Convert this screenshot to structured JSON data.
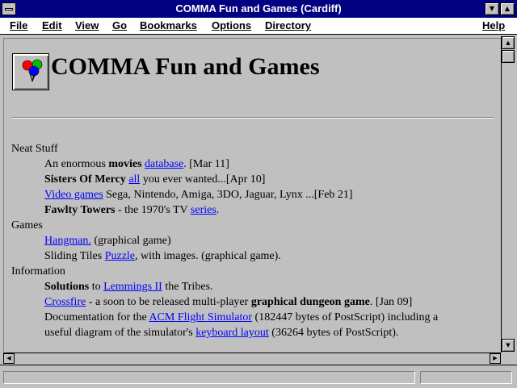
{
  "window": {
    "title": "COMMA Fun and Games (Cardiff)"
  },
  "menu": [
    "File",
    "Edit",
    "View",
    "Go",
    "Bookmarks",
    "Options",
    "Directory",
    "Help"
  ],
  "page": {
    "heading": "COMMA Fun and Games",
    "sections": {
      "neat": "Neat Stuff",
      "games": "Games",
      "info": "Information"
    },
    "lines": {
      "movies": {
        "pre": "An enormous ",
        "bold": "movies",
        "link": "database",
        "post": ". [Mar 11]"
      },
      "sisters": {
        "bold": "Sisters Of Mercy",
        "link": "all",
        "post": " you ever wanted...[Apr 10]"
      },
      "videogames": {
        "link": "Video games",
        "post": " Sega, Nintendo, Amiga, 3DO, Jaguar, Lynx ...[Feb 21]"
      },
      "fawlty": {
        "bold": "Fawlty Towers",
        "mid": " - the 1970's TV ",
        "link": "series",
        "post": "."
      },
      "hangman": {
        "link": "Hangman.",
        "post": " (graphical game)"
      },
      "tiles": {
        "pre": "Sliding Tiles ",
        "link": "Puzzle",
        "post": ", with images. (graphical game)."
      },
      "lemmings": {
        "bold": "Solutions",
        "mid": " to ",
        "link": "Lemmings II",
        "post": " the Tribes."
      },
      "crossfire": {
        "link": "Crossfire",
        "mid": " - a soon to be released multi-player ",
        "bold": "graphical dungeon game",
        "post": ". [Jan 09]"
      },
      "acm1": {
        "pre": "Documentation for the ",
        "link": "ACM Flight Simulator",
        "post": " (182447 bytes of PostScript) including a"
      },
      "acm2": {
        "pre": "useful diagram of the simulator's ",
        "link": "keyboard layout",
        "post": " (36264 bytes of PostScript)."
      }
    }
  }
}
